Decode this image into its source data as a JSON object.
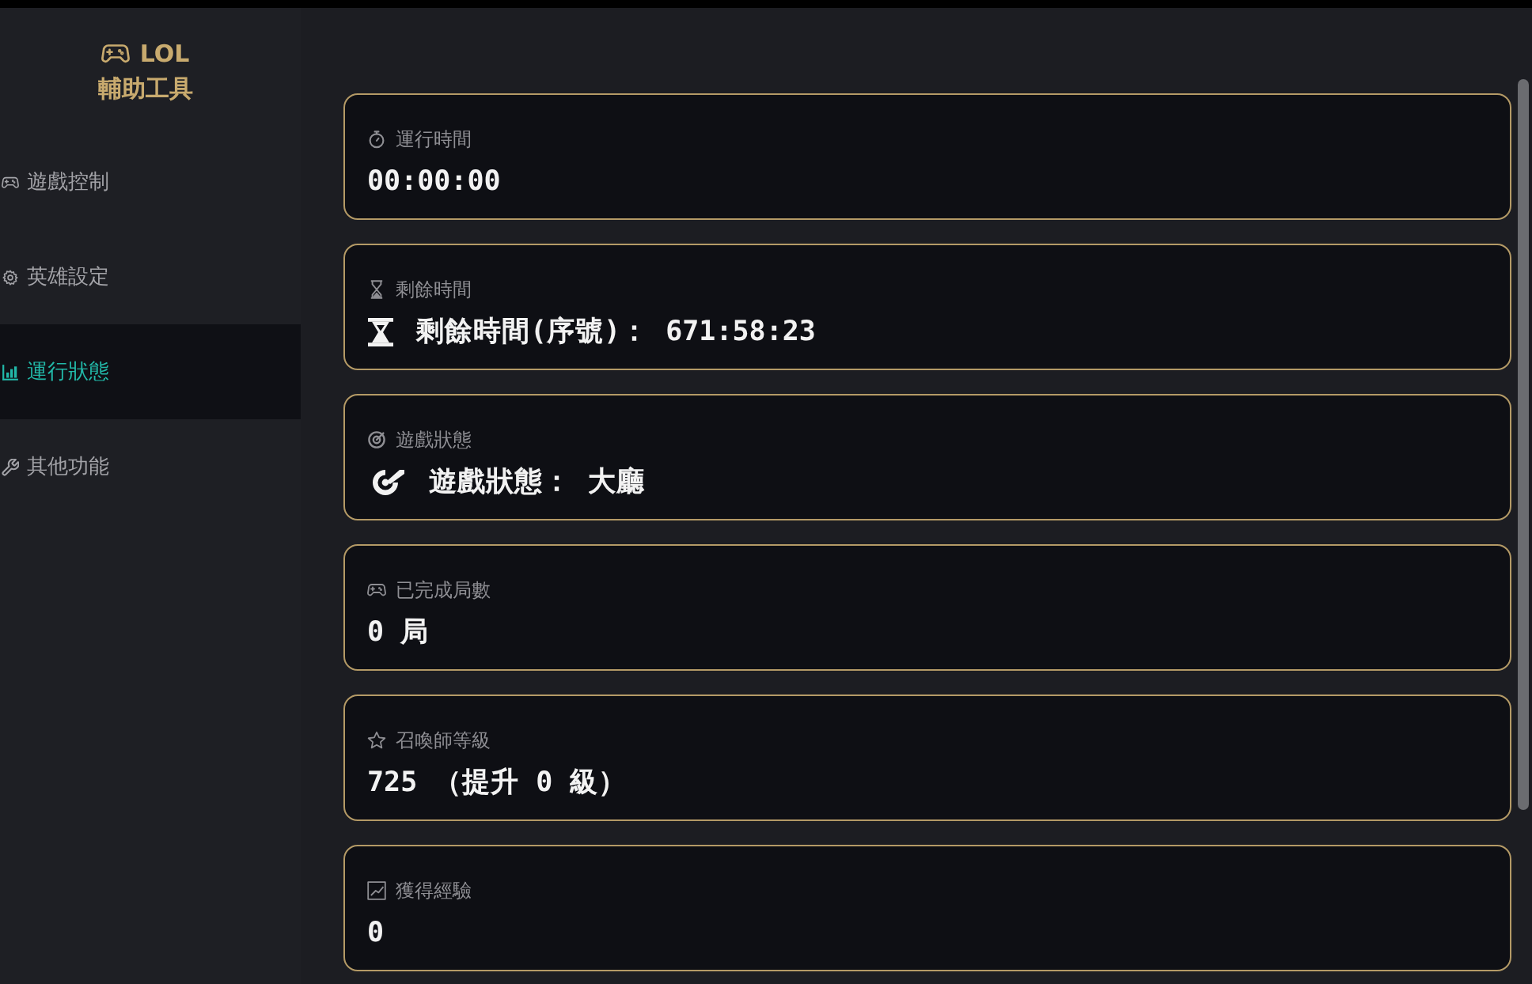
{
  "sidebar": {
    "logo": {
      "title": "LOL",
      "subtitle": "輔助工具"
    },
    "items": [
      {
        "label": "遊戲控制",
        "selected": false
      },
      {
        "label": "英雄設定",
        "selected": false
      },
      {
        "label": "運行狀態",
        "selected": true
      },
      {
        "label": "其他功能",
        "selected": false
      }
    ]
  },
  "stats": [
    {
      "label": "運行時間",
      "value": "00:00:00"
    },
    {
      "label": "剩餘時間",
      "value": "剩餘時間(序號)： 671:58:23"
    },
    {
      "label": "遊戲狀態",
      "value": "遊戲狀態： 大廳"
    },
    {
      "label": "已完成局數",
      "value": "0 局"
    },
    {
      "label": "召喚師等級",
      "value": "725 （提升 0 級）"
    },
    {
      "label": "獲得經驗",
      "value": "0"
    }
  ]
}
